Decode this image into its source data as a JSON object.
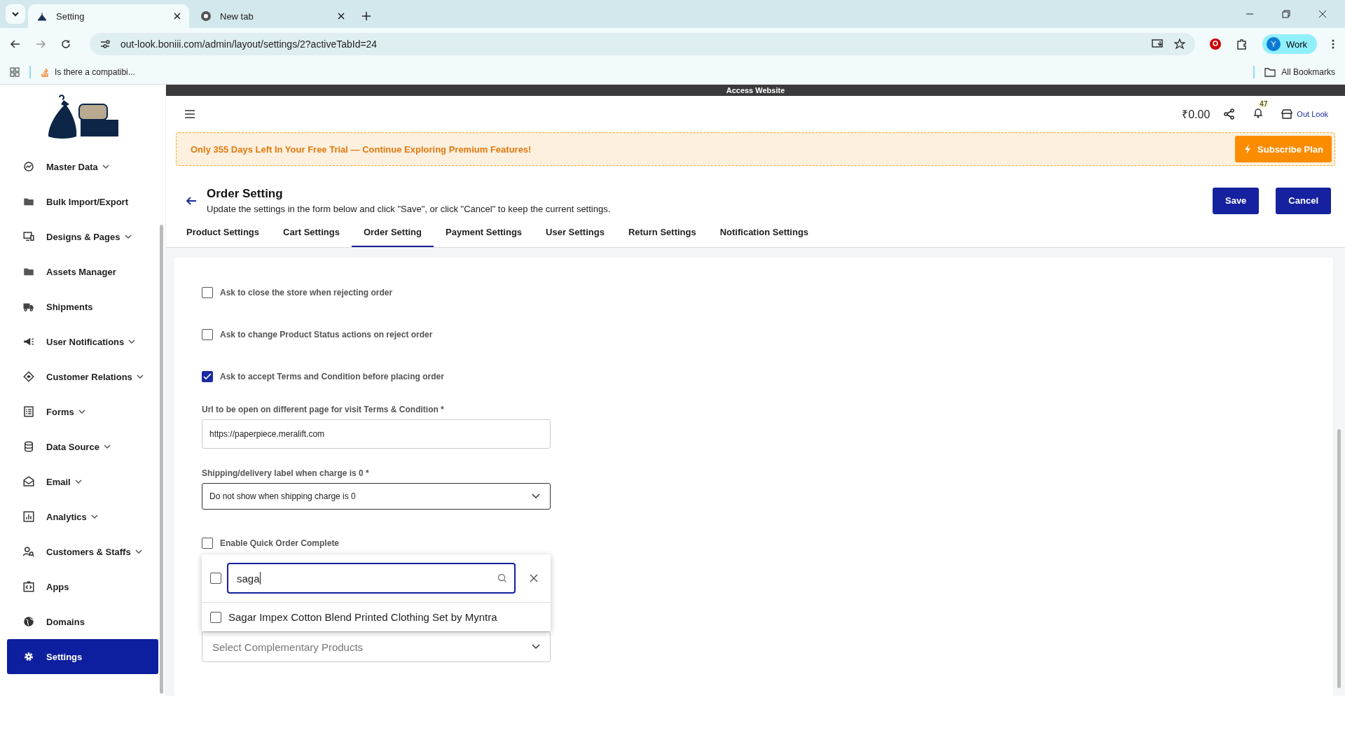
{
  "browser": {
    "tabs": [
      {
        "title": "Setting",
        "selected": true
      },
      {
        "title": "New tab",
        "selected": false
      }
    ],
    "url": "out-look.boniii.com/admin/layout/settings/2?activeTabId=24",
    "profile_initial": "Y",
    "profile_label": "Work",
    "bookmarks": [
      "Is there a compatibi..."
    ],
    "all_bookmarks": "All Bookmarks"
  },
  "access_bar": "Access Website",
  "sidebar": {
    "items": [
      {
        "label": "Master Data",
        "expandable": true,
        "selected": false
      },
      {
        "label": "Bulk Import/Export",
        "expandable": false,
        "selected": false
      },
      {
        "label": "Designs & Pages",
        "expandable": true,
        "selected": false
      },
      {
        "label": "Assets Manager",
        "expandable": false,
        "selected": false
      },
      {
        "label": "Shipments",
        "expandable": false,
        "selected": false
      },
      {
        "label": "User Notifications",
        "expandable": true,
        "selected": false
      },
      {
        "label": "Customer Relations",
        "expandable": true,
        "selected": false
      },
      {
        "label": "Forms",
        "expandable": true,
        "selected": false
      },
      {
        "label": "Data Source",
        "expandable": true,
        "selected": false
      },
      {
        "label": "Email",
        "expandable": true,
        "selected": false
      },
      {
        "label": "Analytics",
        "expandable": true,
        "selected": false
      },
      {
        "label": "Customers & Staffs",
        "expandable": true,
        "selected": false
      },
      {
        "label": "Apps",
        "expandable": false,
        "selected": false
      },
      {
        "label": "Domains",
        "expandable": false,
        "selected": false
      },
      {
        "label": "Settings",
        "expandable": false,
        "selected": true
      }
    ]
  },
  "header": {
    "balance": "₹0.00",
    "notification_count": "47",
    "store_name": "Out Look"
  },
  "trial_banner": {
    "message": "Only 355 Days Left In Your Free Trial — Continue Exploring Premium Features!",
    "button": "Subscribe Plan"
  },
  "page": {
    "title": "Order Setting",
    "subtitle": "Update the settings in the form below and click \"Save\", or click \"Cancel\" to keep the current settings.",
    "buttons": [
      "Save",
      "Cancel"
    ]
  },
  "tabs": [
    {
      "label": "Product Settings",
      "selected": false
    },
    {
      "label": "Cart Settings",
      "selected": false
    },
    {
      "label": "Order Setting",
      "selected": true
    },
    {
      "label": "Payment Settings",
      "selected": false
    },
    {
      "label": "User Settings",
      "selected": false
    },
    {
      "label": "Return Settings",
      "selected": false
    },
    {
      "label": "Notification Settings",
      "selected": false
    }
  ],
  "form": [
    {
      "kind": "checkbox",
      "label": "Ask to close the store when rejecting order",
      "checked": false
    },
    {
      "kind": "checkbox",
      "label": "Ask to change Product Status actions on reject order",
      "checked": false
    },
    {
      "kind": "checkbox",
      "label": "Ask to accept Terms and Condition before placing order",
      "checked": true
    },
    {
      "kind": "text",
      "label": "Url to be open on different page for visit Terms & Condition *",
      "value": "https://paperpiece.meralift.com"
    },
    {
      "kind": "select",
      "label": "Shipping/delivery label when charge is 0 *",
      "value": "Do not show when shipping charge is 0"
    },
    {
      "kind": "checkbox",
      "label": "Enable Quick Order Complete",
      "checked": false
    },
    {
      "kind": "multiselect",
      "placeholder": "Select Complementary Products",
      "open": true,
      "search": "saga",
      "select_all_checked": false,
      "options": [
        {
          "label": "Sagar Impex Cotton Blend Printed Clothing Set by Myntra",
          "checked": false
        }
      ]
    }
  ]
}
